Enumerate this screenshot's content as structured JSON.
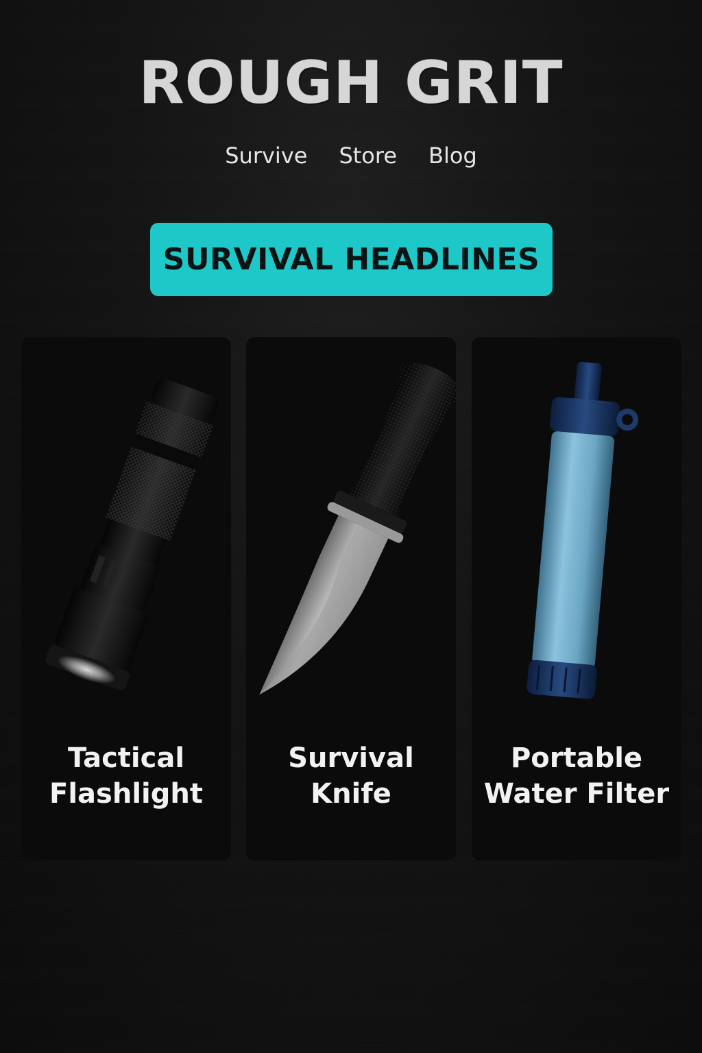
{
  "brand": {
    "name": "ROUGH GRIT"
  },
  "nav": {
    "items": [
      {
        "label": "Survive"
      },
      {
        "label": "Store"
      },
      {
        "label": "Blog"
      }
    ]
  },
  "cta": {
    "label": "SURVIVAL HEADLINES",
    "color": "#1ec8c8"
  },
  "products": [
    {
      "title_line1": "Tactical",
      "title_line2": "Flashlight",
      "icon": "flashlight-icon"
    },
    {
      "title_line1": "Survival",
      "title_line2": "Knife",
      "icon": "knife-icon"
    },
    {
      "title_line1": "Portable",
      "title_line2": "Water Filter",
      "icon": "water-filter-icon"
    }
  ]
}
